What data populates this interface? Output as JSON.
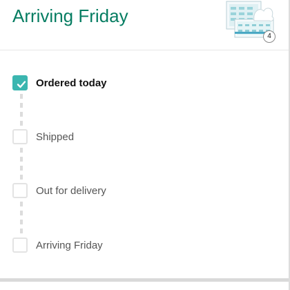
{
  "header": {
    "title": "Arriving Friday",
    "item_quantity": "4",
    "product_image": "tissue-box-pack-icon"
  },
  "tracker": {
    "steps": [
      {
        "label": "Ordered today",
        "checked": true
      },
      {
        "label": "Shipped",
        "checked": false
      },
      {
        "label": "Out for delivery",
        "checked": false
      },
      {
        "label": "Arriving Friday",
        "checked": false
      }
    ]
  },
  "colors": {
    "title": "#067d62",
    "checked": "#3bb6b0",
    "unchecked_border": "#e3e3e3",
    "connector": "#dcdcdc"
  }
}
